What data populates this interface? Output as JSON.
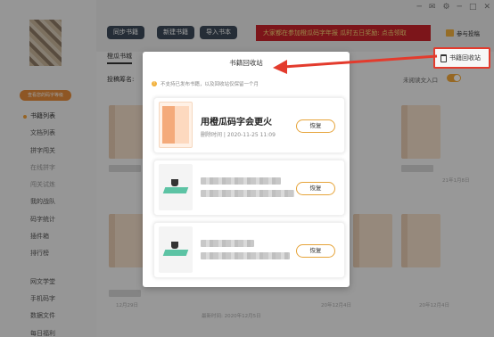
{
  "window": {
    "controls": [
      "─",
      "✉",
      "⚙",
      "─",
      "□",
      "✕"
    ]
  },
  "sidebar": {
    "level_badge": "查看您的码字等级",
    "items": [
      {
        "label": "书籍列表",
        "state": "active"
      },
      {
        "label": "文档列表",
        "state": "normal"
      },
      {
        "label": "拼字闯关",
        "state": "normal"
      },
      {
        "label": "在线拼字",
        "state": "faded"
      },
      {
        "label": "闯关试炼",
        "state": "faded"
      },
      {
        "label": "我的战队",
        "state": "normal"
      },
      {
        "label": "码字统计",
        "state": "normal"
      },
      {
        "label": "插件箱",
        "state": "normal"
      },
      {
        "label": "排行榜",
        "state": "normal"
      },
      {
        "label": "网文学堂",
        "state": "normal"
      },
      {
        "label": "手机码字",
        "state": "normal"
      },
      {
        "label": "数据文件",
        "state": "normal"
      },
      {
        "label": "每日福利",
        "state": "normal"
      }
    ]
  },
  "toolbar": {
    "sync_label": "同步书籍",
    "new_label": "新建书籍",
    "import_label": "导入书本",
    "promo_text": "大家都在参加橙瓜码字年报  瓜时五日奖励: 点击领取",
    "contribute_label": "参与投稿",
    "tab_label": "橙瓜书城",
    "recycle_label": "书籍回收站"
  },
  "filter": {
    "label": "投稿筹名:",
    "right_label": "未阅读文入口"
  },
  "background": {
    "dates": [
      "12月29日",
      "最新时间: 2020年12月5日",
      "20年12月4日",
      "20年12月4日",
      "21年1月8日"
    ]
  },
  "dialog": {
    "title": "书籍回收站",
    "notice": "不支持已发布书籍，以及回收站仅保留一个月",
    "books": [
      {
        "title": "用橙瓜码字会更火",
        "meta": "删除时间 | 2020-11-25 11:09",
        "restore": "恢复",
        "cover": "orange",
        "blurred": false
      },
      {
        "title": "",
        "meta": "",
        "restore": "恢复",
        "cover": "teal",
        "blurred": true
      },
      {
        "title": "",
        "meta": "",
        "restore": "恢复",
        "cover": "teal",
        "blurred": true
      }
    ]
  },
  "colors": {
    "accent": "#f2a93b",
    "annotation": "#e33b2d",
    "toolbar_button": "#3c4a5a",
    "promo": "#c9232a"
  }
}
